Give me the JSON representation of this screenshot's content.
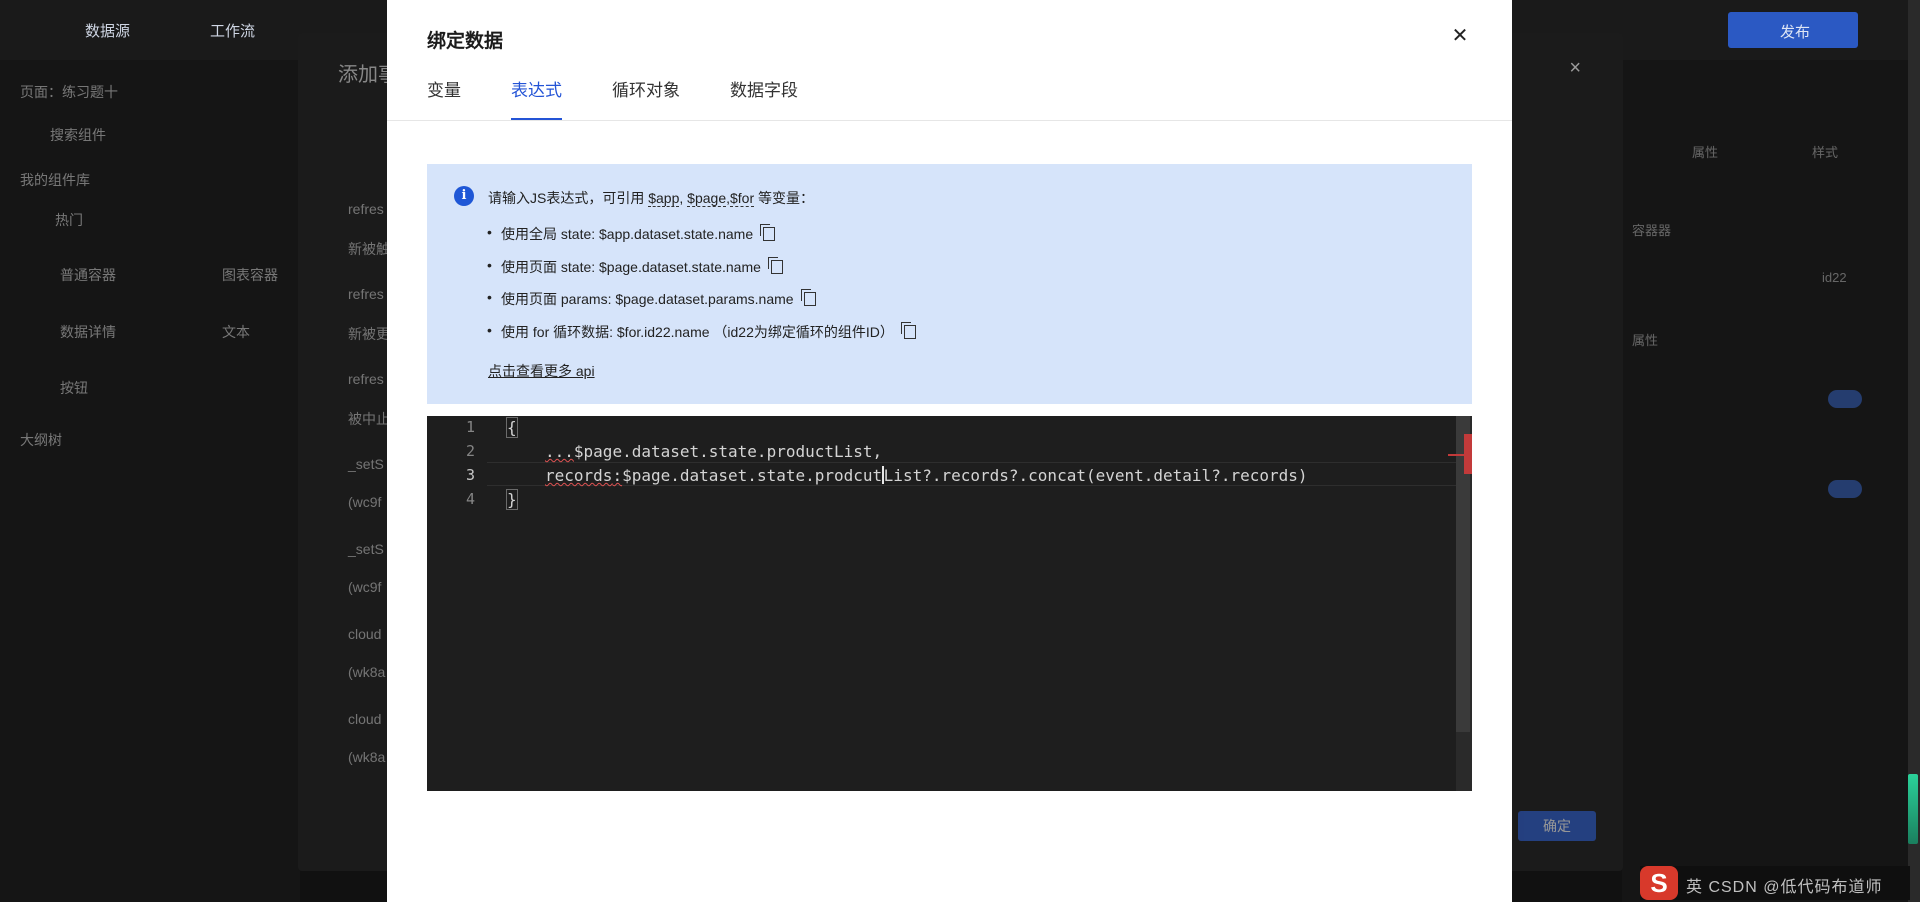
{
  "background": {
    "topnav": [
      "数据源",
      "工作流",
      "发布"
    ],
    "left_panel": [
      "页面：练习题十",
      "搜索组件",
      "我的组件库",
      "热门",
      "普通容器",
      "数据详情",
      "按钮",
      "大纲树",
      "图表容器",
      "文本"
    ],
    "right_panel": [
      "属性",
      "样式",
      "容器器",
      "id22",
      "属性"
    ],
    "bg_dialog": {
      "title": "添加事",
      "items": [
        "refres",
        "新被触",
        "refres",
        "新被更",
        "refres",
        "被中止",
        "_setS",
        "(wc9f",
        "_setS",
        "(wc9f",
        "cloud",
        "(wk8a",
        "cloud",
        "(wk8a"
      ],
      "confirm_label": "确定"
    },
    "ime": {
      "badge": "S",
      "text": "英 CSDN @低代码布道师"
    }
  },
  "modal": {
    "title": "绑定数据",
    "tabs": [
      {
        "label": "变量",
        "active": false
      },
      {
        "label": "表达式",
        "active": true
      },
      {
        "label": "循环对象",
        "active": false
      },
      {
        "label": "数据字段",
        "active": false
      }
    ],
    "info": {
      "head_prefix": "请输入JS表达式，可引用 ",
      "app_var": "$app",
      "sep1": ", ",
      "page_var": "$page",
      "sep2": ",",
      "for_var": "$for",
      "head_suffix": " 等变量：",
      "bullets": [
        "使用全局 state: $app.dataset.state.name",
        "使用页面 state: $page.dataset.state.name",
        "使用页面 params: $page.dataset.params.name",
        "使用 for 循环数据: $for.id22.name （id22为绑定循环的组件ID）"
      ],
      "more_link": "点击查看更多 api"
    },
    "editor": {
      "line_numbers": [
        "1",
        "2",
        "3",
        "4"
      ],
      "lines": {
        "l1": "{",
        "l2_prefix": "...",
        "l2_rest": "$page.dataset.state.productList,",
        "l3_word": "records",
        "l3_colon": ":",
        "l3_a": "$page.dataset.state.prodcut",
        "l3_b": "List?.records?.concat(event.detail?.records)",
        "l4": "}"
      }
    }
  }
}
